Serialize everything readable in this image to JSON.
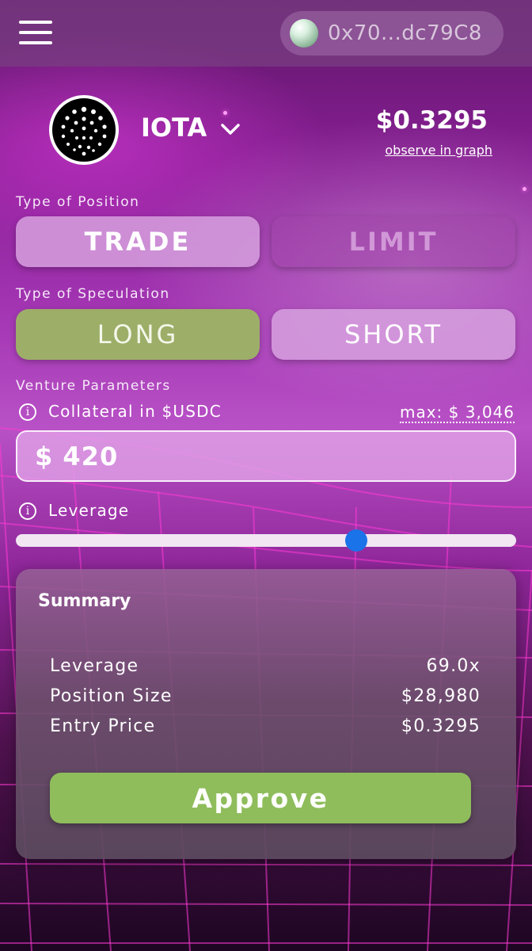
{
  "header": {
    "wallet_address": "0x70...dc79C8"
  },
  "token": {
    "name": "IOTA",
    "price": "$0.3295",
    "observe_link": "observe in graph"
  },
  "position_type": {
    "label": "Type of Position",
    "options": [
      "TRADE",
      "LIMIT"
    ],
    "selected": "TRADE"
  },
  "speculation_type": {
    "label": "Type of Speculation",
    "options": [
      "LONG",
      "SHORT"
    ],
    "selected": "LONG"
  },
  "venture": {
    "label": "Venture Parameters",
    "collateral_label": "Collateral in $USDC",
    "max_label": "max: $ 3,046",
    "collateral_value": "$ 420",
    "leverage_label": "Leverage",
    "leverage_slider_fraction": 0.68
  },
  "summary": {
    "title": "Summary",
    "rows": [
      {
        "label": "Leverage",
        "value": "69.0x"
      },
      {
        "label": "Position Size",
        "value": "$28,980"
      },
      {
        "label": "Entry Price",
        "value": "$0.3295"
      }
    ],
    "approve_label": "Approve"
  },
  "colors": {
    "long_green": "#9dae68",
    "approve_green": "#8fbd5c",
    "slider_thumb": "#1a73e8"
  }
}
